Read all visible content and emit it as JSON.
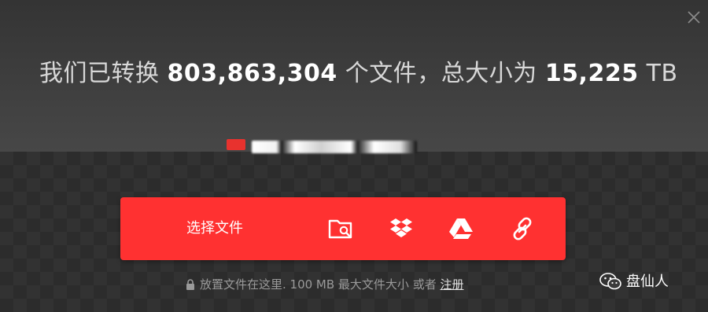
{
  "dialog": {
    "close_icon": "close-icon"
  },
  "stats": {
    "prefix": "我们已转换",
    "files_count": "803,863,304",
    "middle": "个文件，总大小为",
    "total_size": "15,225",
    "unit": "TB"
  },
  "upload": {
    "choose_label": "选择文件",
    "sources": [
      {
        "name": "folder-search-icon"
      },
      {
        "name": "dropbox-icon"
      },
      {
        "name": "google-drive-icon"
      },
      {
        "name": "link-icon"
      }
    ],
    "accent_color": "#ff3131"
  },
  "footer": {
    "lock_icon": "lock-icon",
    "text": "放置文件在这里. 100 MB 最大文件大小 或者",
    "register_label": "注册"
  },
  "watermark": {
    "icon": "wechat-icon",
    "label": "盘仙人"
  }
}
